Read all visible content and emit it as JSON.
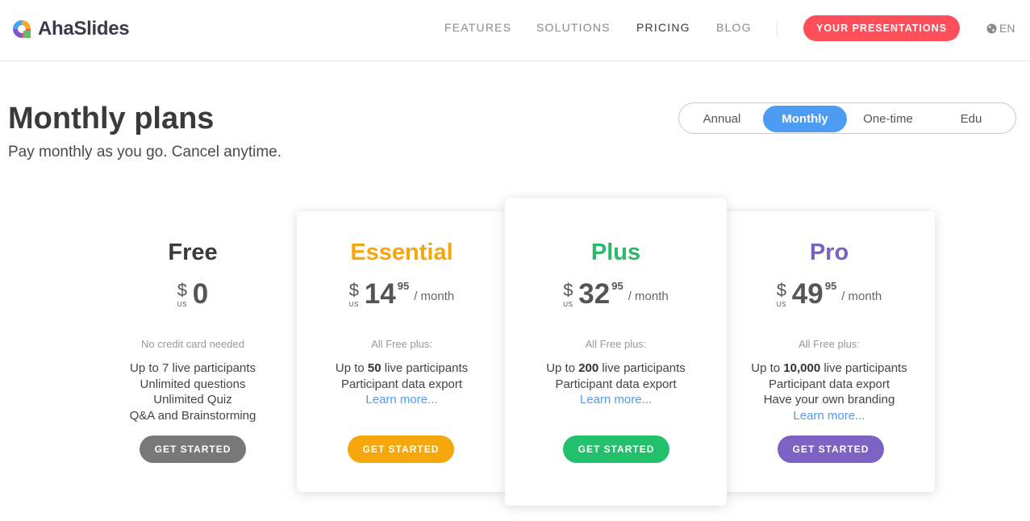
{
  "brand": {
    "name": "AhaSlides"
  },
  "nav": {
    "items": [
      {
        "label": "FEATURES"
      },
      {
        "label": "SOLUTIONS"
      },
      {
        "label": "PRICING"
      },
      {
        "label": "BLOG"
      }
    ],
    "active": "PRICING",
    "cta_label": "YOUR PRESENTATIONS",
    "language": "EN"
  },
  "page": {
    "title": "Monthly plans",
    "subtitle": "Pay monthly as you go. Cancel anytime."
  },
  "billing_toggle": {
    "options": [
      "Annual",
      "Monthly",
      "One-time",
      "Edu"
    ],
    "selected": "Monthly"
  },
  "plans": [
    {
      "name": "Free",
      "color": "#3a3a3a",
      "currency": "$",
      "currency_code": "US",
      "amount": "0",
      "cents": "",
      "period": "",
      "note": "No credit card needed",
      "features": [
        "Up to 7 live participants",
        "Unlimited questions",
        "Unlimited Quiz",
        "Q&A and Brainstorming"
      ],
      "learn_more": "",
      "button": "GET STARTED",
      "button_color": "#787878"
    },
    {
      "name": "Essential",
      "color": "#f6a60f",
      "currency": "$",
      "currency_code": "US",
      "amount": "14",
      "cents": "95",
      "period": "/ month",
      "note": "All Free plus:",
      "features_prefix": "Up to ",
      "features_bold": "50",
      "features_suffix": " live participants",
      "features": [
        "Participant data export"
      ],
      "learn_more": "Learn more...",
      "button": "GET STARTED",
      "button_color": "#f6a70c"
    },
    {
      "name": "Plus",
      "color": "#2cb96a",
      "currency": "$",
      "currency_code": "US",
      "amount": "32",
      "cents": "95",
      "period": "/ month",
      "note": "All Free plus:",
      "features_prefix": "Up to ",
      "features_bold": "200",
      "features_suffix": " live participants",
      "features": [
        "Participant data export"
      ],
      "learn_more": "Learn more...",
      "button": "GET STARTED",
      "button_color": "#22c06b"
    },
    {
      "name": "Pro",
      "color": "#7b62c0",
      "currency": "$",
      "currency_code": "US",
      "amount": "49",
      "cents": "95",
      "period": "/ month",
      "note": "All Free plus:",
      "features_prefix": "Up to ",
      "features_bold": "10,000",
      "features_suffix": " live participants",
      "features": [
        "Participant data export",
        "Have your own branding"
      ],
      "learn_more": "Learn more...",
      "button": "GET STARTED",
      "button_color": "#7b62c3"
    }
  ],
  "icons": {
    "logo": "ahaslides-logo-icon",
    "language": "globe-icon"
  },
  "colors": {
    "accent": "#ff4d5a",
    "toggle_selected": "#4d9cf4",
    "link": "#4d9cf4"
  }
}
